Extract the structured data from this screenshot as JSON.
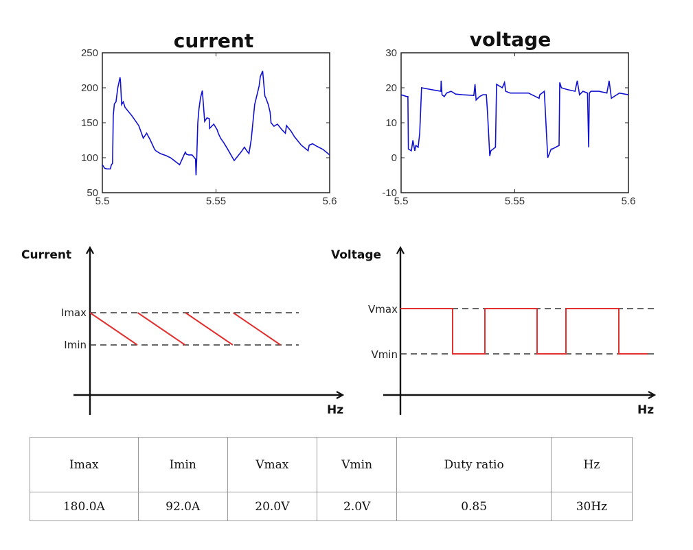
{
  "chart_data": [
    {
      "type": "line",
      "title": "current",
      "xlabel": "",
      "ylabel": "",
      "xlim": [
        5.5,
        5.6
      ],
      "ylim": [
        50,
        250
      ],
      "xticks": [
        "5.5",
        "5.55",
        "5.6"
      ],
      "yticks": [
        "250",
        "200",
        "150",
        "100",
        "50"
      ],
      "color": "#1010d0",
      "series": [
        {
          "name": "current",
          "x": [
            5.5,
            5.501,
            5.502,
            5.5035,
            5.504,
            5.5045,
            5.5048,
            5.5053,
            5.506,
            5.5068,
            5.5078,
            5.508,
            5.5085,
            5.5092,
            5.51,
            5.513,
            5.516,
            5.518,
            5.5195,
            5.521,
            5.523,
            5.5235,
            5.5255,
            5.528,
            5.53,
            5.534,
            5.5365,
            5.537,
            5.538,
            5.5395,
            5.541,
            5.5412,
            5.5415,
            5.542,
            5.5425,
            5.5432,
            5.544,
            5.545,
            5.546,
            5.547,
            5.5472,
            5.549,
            5.5505,
            5.551,
            5.552,
            5.5535,
            5.555,
            5.558,
            5.561,
            5.5625,
            5.5635,
            5.5645,
            5.5655,
            5.567,
            5.5685,
            5.569,
            5.5695,
            5.5705,
            5.5715,
            5.572,
            5.573,
            5.5738,
            5.5742,
            5.5755,
            5.577,
            5.579,
            5.5805,
            5.581,
            5.583,
            5.5845,
            5.586,
            5.5875,
            5.5905,
            5.591,
            5.5925,
            5.594,
            5.597,
            5.6
          ],
          "values": [
            90,
            85,
            84,
            84,
            90,
            92,
            160,
            177,
            180,
            200,
            215,
            208,
            176,
            180,
            172,
            160,
            146,
            128,
            135,
            126,
            112,
            110,
            106,
            103,
            100,
            90,
            108,
            105,
            104,
            104,
            98,
            75,
            98,
            150,
            170,
            186,
            196,
            152,
            157,
            156,
            142,
            148,
            140,
            135,
            128,
            121,
            113,
            96,
            108,
            115,
            110,
            106,
            126,
            176,
            196,
            203,
            216,
            224,
            188,
            185,
            176,
            165,
            150,
            145,
            148,
            140,
            135,
            146,
            138,
            130,
            124,
            118,
            110,
            118,
            120,
            117,
            112,
            104
          ]
        }
      ]
    },
    {
      "type": "line",
      "title": "voltage",
      "xlabel": "",
      "ylabel": "",
      "xlim": [
        5.5,
        5.6
      ],
      "ylim": [
        -10,
        30
      ],
      "xticks": [
        "5.5",
        "5.55",
        "5.6"
      ],
      "yticks": [
        "30",
        "20",
        "10",
        "0",
        "-10"
      ],
      "color": "#1010d0",
      "series": [
        {
          "name": "voltage",
          "x": [
            5.5,
            5.5025,
            5.503,
            5.5032,
            5.5045,
            5.5052,
            5.506,
            5.5065,
            5.5075,
            5.5082,
            5.509,
            5.513,
            5.5175,
            5.5176,
            5.518,
            5.519,
            5.52,
            5.522,
            5.524,
            5.527,
            5.532,
            5.5325,
            5.533,
            5.5345,
            5.536,
            5.5375,
            5.538,
            5.539,
            5.5395,
            5.5415,
            5.542,
            5.5445,
            5.5455,
            5.546,
            5.548,
            5.552,
            5.556,
            5.5607,
            5.561,
            5.563,
            5.5645,
            5.566,
            5.5665,
            5.5695,
            5.5698,
            5.5705,
            5.573,
            5.5765,
            5.5775,
            5.5785,
            5.58,
            5.582,
            5.5825,
            5.5828,
            5.5835,
            5.587,
            5.5905,
            5.5915,
            5.5925,
            5.596,
            5.6
          ],
          "values": [
            18,
            17.5,
            17.5,
            2.5,
            2,
            5,
            2,
            3.5,
            3,
            7,
            20,
            19.5,
            19,
            22,
            18,
            17.5,
            18.5,
            19,
            18.2,
            18,
            17.8,
            21,
            16.5,
            17.5,
            18,
            18,
            13,
            0.5,
            2,
            3,
            21,
            20,
            21.5,
            19,
            18.5,
            18.5,
            18.5,
            17,
            18,
            19,
            0,
            2.5,
            2.5,
            3.5,
            21.5,
            20,
            19.5,
            19,
            22,
            18,
            19,
            18.5,
            3,
            18.5,
            19,
            19,
            18.5,
            22,
            17,
            18.5,
            18
          ]
        }
      ]
    }
  ],
  "diagrams": {
    "current": {
      "y_axis_label": "Current",
      "x_axis_label": "Hz",
      "upper_level_label": "Imax",
      "lower_level_label": "Imin",
      "ramp_count": 4,
      "line_color": "#e23030"
    },
    "voltage": {
      "y_axis_label": "Voltage",
      "x_axis_label": "Hz",
      "upper_level_label": "Vmax",
      "lower_level_label": "Vmin",
      "pulse_pattern": [
        "high",
        "low",
        "high",
        "low",
        "high",
        "low"
      ],
      "line_color": "#e23030"
    }
  },
  "table": {
    "headers": [
      "Imax",
      "Imin",
      "Vmax",
      "Vmin",
      "Duty ratio",
      "Hz"
    ],
    "values": [
      "180.0A",
      "92.0A",
      "20.0V",
      "2.0V",
      "0.85",
      "30Hz"
    ]
  }
}
